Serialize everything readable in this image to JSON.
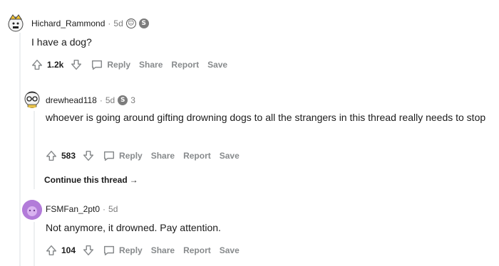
{
  "comments": [
    {
      "username": "Hichard_Rammond",
      "time": "5d",
      "award_count": "",
      "body": "I have a dog?",
      "score": "1.2k",
      "actions": {
        "reply": "Reply",
        "share": "Share",
        "report": "Report",
        "save": "Save"
      }
    },
    {
      "username": "drewhead118",
      "time": "5d",
      "award_count": "3",
      "body": "whoever is going around gifting drowning dogs to all the strangers in this thread really needs to stop",
      "score": "583",
      "actions": {
        "reply": "Reply",
        "share": "Share",
        "report": "Report",
        "save": "Save"
      }
    },
    {
      "username": "FSMFan_2pt0",
      "time": "5d",
      "award_count": "",
      "body": "Not anymore, it drowned. Pay attention.",
      "score": "104",
      "actions": {
        "reply": "Reply",
        "share": "Share",
        "report": "Report",
        "save": "Save"
      }
    }
  ],
  "continue_thread": "Continue this thread",
  "separator": "·",
  "colors": {
    "text": "#1c1c1c",
    "meta": "#7c7c7c",
    "action": "#878a8c",
    "thread_line": "#edeff1",
    "avatar3": "#b27bd9"
  }
}
